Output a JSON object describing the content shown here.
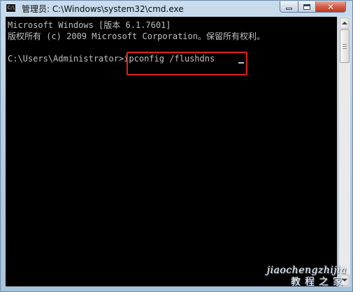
{
  "window": {
    "title": "管理员: C:\\Windows\\system32\\cmd.exe",
    "icon": "cmd-icon",
    "icon_text": "C:\\",
    "controls": {
      "minimize": "minimize-icon",
      "maximize": "maximize-icon",
      "close": "✕"
    }
  },
  "console": {
    "lines": [
      "Microsoft Windows [版本 6.1.7601]",
      "版权所有 (c) 2009 Microsoft Corporation。保留所有权利。",
      "",
      "C:\\Users\\Administrator>ipconfig /flushdns"
    ],
    "colors": {
      "background": "#000000",
      "text": "#c0c0c0",
      "highlight_box": "#e0201c"
    }
  },
  "watermark": {
    "line1": "jiaochengzhijia",
    "line2": "教程之家"
  }
}
